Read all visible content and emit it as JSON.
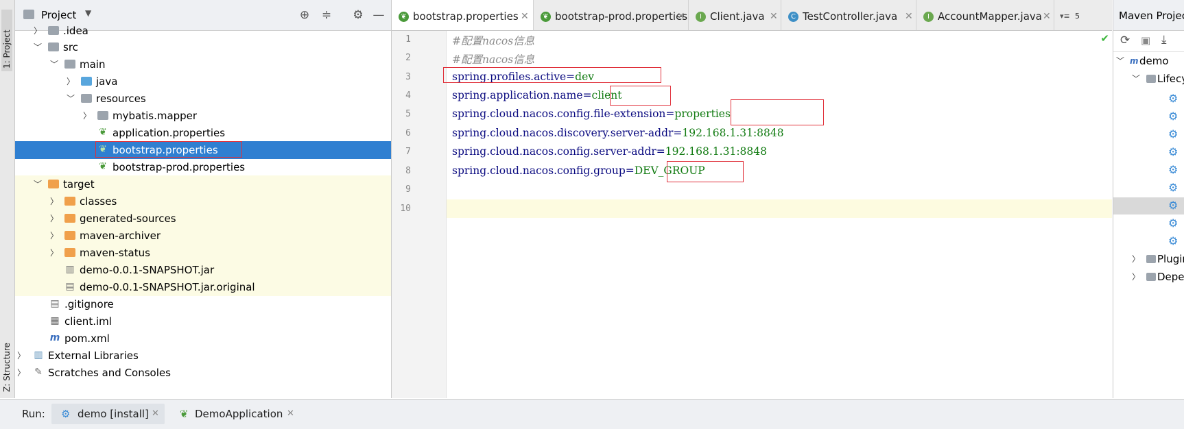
{
  "left_strip": {
    "project_tab": "1: Project",
    "structure_tab": "Z: Structure"
  },
  "project": {
    "title": "Project",
    "tree": [
      {
        "label": ".idea",
        "icon": "folder-icon"
      },
      {
        "label": "src",
        "icon": "folder-icon"
      },
      {
        "label": "main",
        "icon": "folder-icon"
      },
      {
        "label": "java",
        "icon": "source-folder-icon"
      },
      {
        "label": "resources",
        "icon": "resources-folder-icon"
      },
      {
        "label": "mybatis.mapper",
        "icon": "package-icon"
      },
      {
        "label": "application.properties",
        "icon": "spring-properties-icon"
      },
      {
        "label": "bootstrap.properties",
        "icon": "spring-properties-icon"
      },
      {
        "label": "bootstrap-prod.properties",
        "icon": "spring-properties-icon"
      },
      {
        "label": "target",
        "icon": "excluded-folder-icon"
      },
      {
        "label": "classes",
        "icon": "excluded-folder-icon"
      },
      {
        "label": "generated-sources",
        "icon": "excluded-folder-icon"
      },
      {
        "label": "maven-archiver",
        "icon": "excluded-folder-icon"
      },
      {
        "label": "maven-status",
        "icon": "excluded-folder-icon"
      },
      {
        "label": "demo-0.0.1-SNAPSHOT.jar",
        "icon": "jar-icon"
      },
      {
        "label": "demo-0.0.1-SNAPSHOT.jar.original",
        "icon": "file-icon"
      },
      {
        "label": ".gitignore",
        "icon": "text-file-icon"
      },
      {
        "label": "client.iml",
        "icon": "iml-file-icon"
      },
      {
        "label": "pom.xml",
        "icon": "maven-icon"
      },
      {
        "label": "External Libraries",
        "icon": "libraries-icon"
      },
      {
        "label": "Scratches and Consoles",
        "icon": "scratches-icon"
      }
    ]
  },
  "tabs": [
    {
      "label": "bootstrap.properties",
      "icon": "spring-properties-icon"
    },
    {
      "label": "bootstrap-prod.properties",
      "icon": "spring-properties-icon"
    },
    {
      "label": "Client.java",
      "icon": "interface-icon",
      "badge": "I"
    },
    {
      "label": "TestController.java",
      "icon": "class-icon",
      "badge": "C"
    },
    {
      "label": "AccountMapper.java",
      "icon": "interface-icon",
      "badge": "I"
    }
  ],
  "tab_overflow": "5",
  "editor": {
    "line_numbers": [
      "1",
      "2",
      "3",
      "4",
      "5",
      "6",
      "7",
      "8",
      "9",
      "10"
    ],
    "lines": [
      {
        "comment": "#配置nacos信息"
      },
      {
        "comment": "#配置nacos信息"
      },
      {
        "key": "spring.profiles.active",
        "sep": "=",
        "value": "dev"
      },
      {
        "key": "spring.application.name",
        "sep": "=",
        "value": "client"
      },
      {
        "key": "spring.cloud.nacos.config.file-extension",
        "sep": "=",
        "value": "properties"
      },
      {
        "key": "spring.cloud.nacos.discovery.server-addr",
        "sep": "=",
        "value": "192.168.1.31:8848"
      },
      {
        "key": "spring.cloud.nacos.config.server-addr",
        "sep": "=",
        "value": "192.168.1.31:8848"
      },
      {
        "key": "spring.cloud.nacos.config.group",
        "sep": "=",
        "value": "DEV_GROUP"
      }
    ]
  },
  "maven": {
    "title": "Maven Projects",
    "root": "demo",
    "lifecycle": "Lifecycle",
    "plugins": "Plugins",
    "dependencies": "Dependencies"
  },
  "run": {
    "label": "Run:",
    "tabs": [
      "demo [install]",
      "DemoApplication"
    ]
  },
  "colors": {
    "selection": "#2f7fd1",
    "annotation_box": "#e0303a",
    "value_green": "#107a10",
    "key_navy": "#0a0a80"
  }
}
